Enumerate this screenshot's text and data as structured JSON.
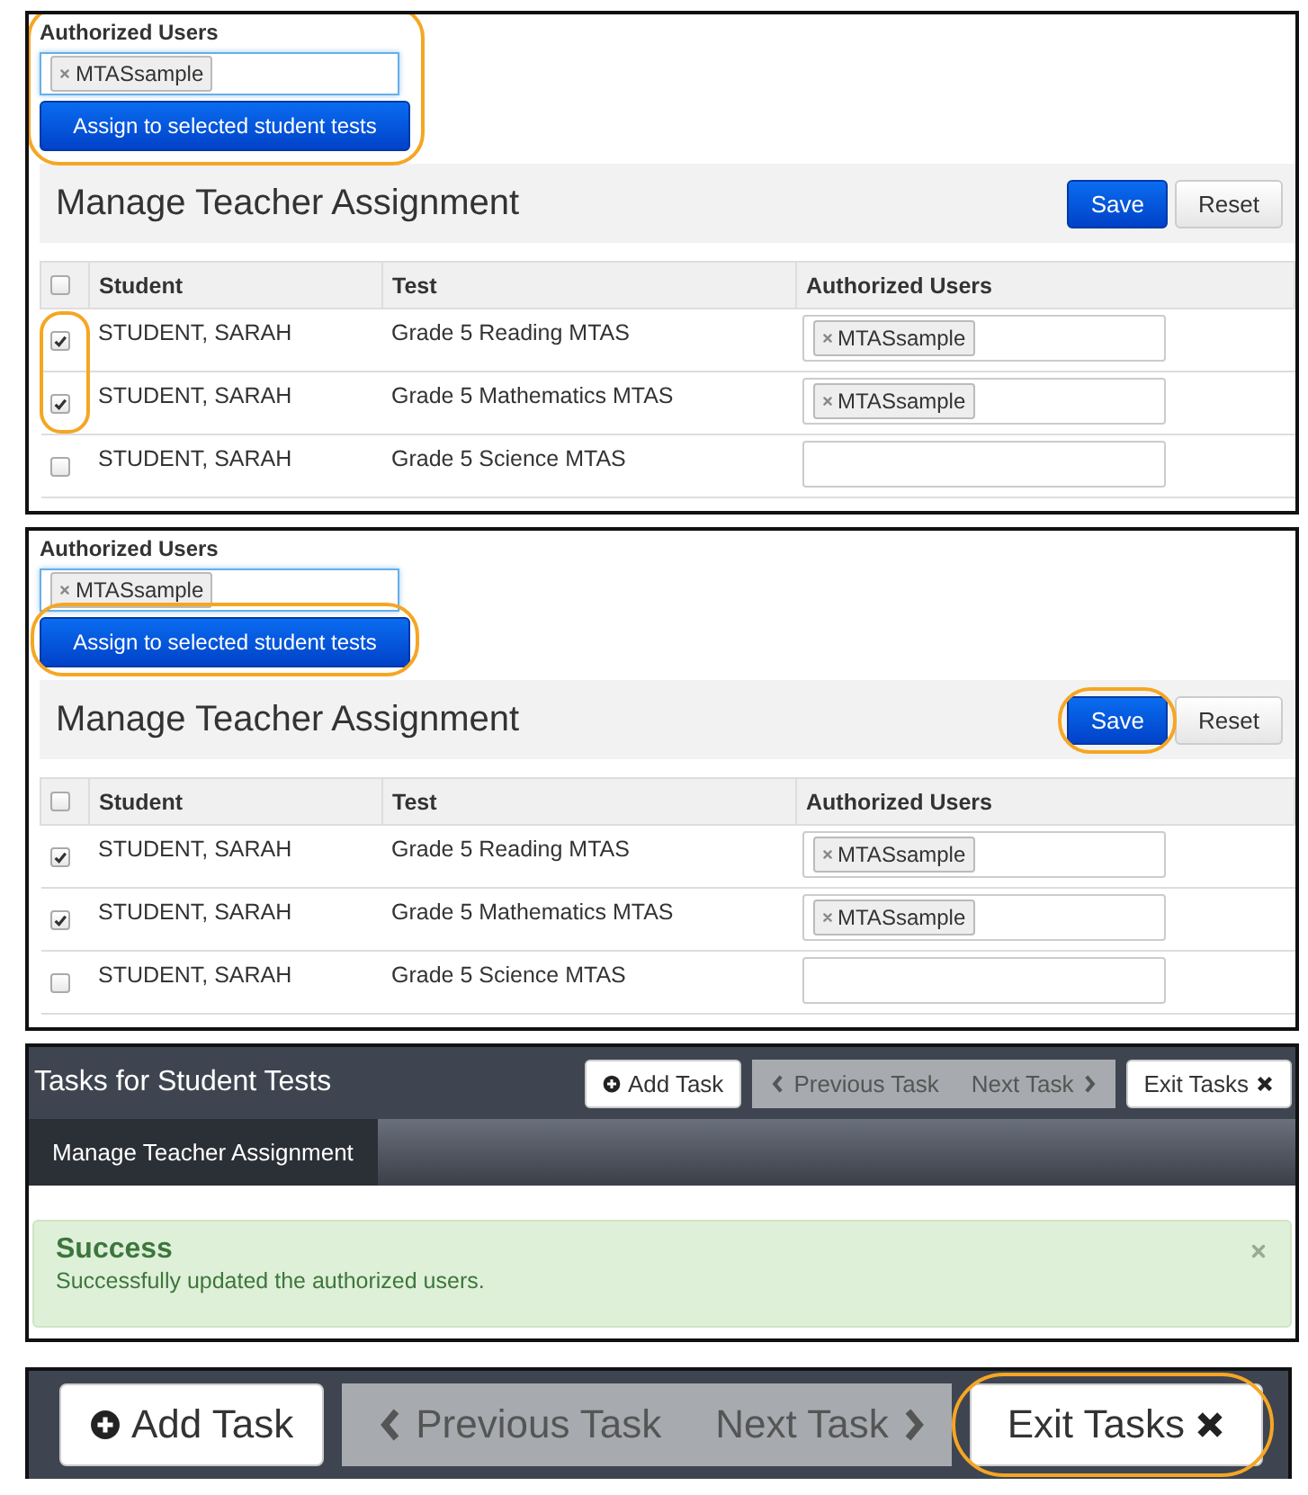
{
  "panels": [
    {
      "kind": "assignment",
      "assign_label": "Authorized Users",
      "assign_field": {
        "tokens": [
          "MTASsample"
        ],
        "focused": true
      },
      "assign_group_highlighted": true,
      "assign_button": {
        "label": "Assign to selected student tests",
        "highlighted": false
      },
      "title": "Manage Teacher Assignment",
      "buttons": [
        {
          "label": "Save",
          "kind": "primary",
          "highlighted": false
        },
        {
          "label": "Reset",
          "kind": "default",
          "highlighted": false
        }
      ],
      "table": {
        "select_all_checked": false,
        "columns": [
          "Student",
          "Test",
          "Authorized Users"
        ],
        "rows": [
          {
            "checked": true,
            "highlighted": true,
            "student": "STUDENT, SARAH",
            "test": "Grade 5 Reading MTAS",
            "users": [
              "MTASsample"
            ]
          },
          {
            "checked": true,
            "highlighted": true,
            "student": "STUDENT, SARAH",
            "test": "Grade 5 Mathematics MTAS",
            "users": [
              "MTASsample"
            ]
          },
          {
            "checked": false,
            "highlighted": false,
            "student": "STUDENT, SARAH",
            "test": "Grade 5 Science MTAS",
            "users": []
          }
        ]
      }
    },
    {
      "kind": "assignment",
      "assign_label": "Authorized Users",
      "assign_field": {
        "tokens": [
          "MTASsample"
        ],
        "focused": true
      },
      "assign_group_highlighted": false,
      "assign_button": {
        "label": "Assign to selected student tests",
        "highlighted": true
      },
      "title": "Manage Teacher Assignment",
      "buttons": [
        {
          "label": "Save",
          "kind": "primary",
          "highlighted": true
        },
        {
          "label": "Reset",
          "kind": "default",
          "highlighted": false
        }
      ],
      "table": {
        "select_all_checked": false,
        "columns": [
          "Student",
          "Test",
          "Authorized Users"
        ],
        "rows": [
          {
            "checked": true,
            "highlighted": false,
            "student": "STUDENT, SARAH",
            "test": "Grade 5 Reading MTAS",
            "users": [
              "MTASsample"
            ]
          },
          {
            "checked": true,
            "highlighted": false,
            "student": "STUDENT, SARAH",
            "test": "Grade 5 Mathematics MTAS",
            "users": [
              "MTASsample"
            ]
          },
          {
            "checked": false,
            "highlighted": false,
            "student": "STUDENT, SARAH",
            "test": "Grade 5 Science MTAS",
            "users": []
          }
        ]
      }
    },
    {
      "kind": "tasks",
      "title": "Tasks for Student Tests",
      "buttons": [
        {
          "kind": "add",
          "label": "Add Task",
          "disabled": false,
          "highlighted": false
        },
        {
          "kind": "prev",
          "label": "Previous Task",
          "disabled": true,
          "highlighted": false
        },
        {
          "kind": "next",
          "label": "Next Task",
          "disabled": true,
          "highlighted": false
        },
        {
          "kind": "exit",
          "label": "Exit Tasks",
          "disabled": false,
          "highlighted": false
        }
      ],
      "tabs": [
        {
          "label": "Manage Teacher Assignment",
          "selected": true
        }
      ],
      "alert": {
        "title": "Success",
        "message": "Successfully updated the authorized users."
      }
    },
    {
      "kind": "task_buttons",
      "buttons": [
        {
          "kind": "add",
          "label": "Add Task",
          "disabled": false,
          "highlighted": false
        },
        {
          "kind": "prev",
          "label": "Previous Task",
          "disabled": true,
          "highlighted": false
        },
        {
          "kind": "next",
          "label": "Next Task",
          "disabled": true,
          "highlighted": false
        },
        {
          "kind": "exit",
          "label": "Exit Tasks",
          "disabled": false,
          "highlighted": true
        }
      ]
    }
  ]
}
